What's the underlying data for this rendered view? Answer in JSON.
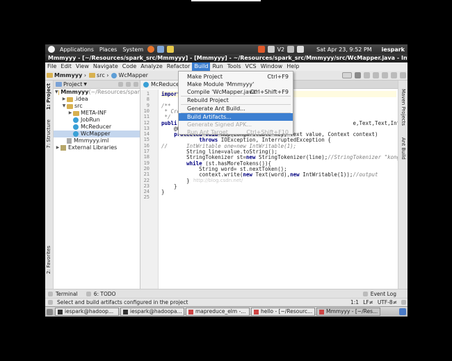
{
  "panel": {
    "menus": [
      "Applications",
      "Places",
      "System"
    ],
    "clock": "Sat Apr 23,  9:52 PM",
    "user": "iespark",
    "indicator": "V2"
  },
  "window": {
    "title": "Mmmyyy - [~/Resources/spark_src/Mmmyyy] - [Mmmyyy] - ~/Resources/spark_src/Mmmyyy/src/WcMapper.java - IntelliJ"
  },
  "menubar": [
    "File",
    "Edit",
    "View",
    "Navigate",
    "Code",
    "Analyze",
    "Refactor",
    "Build",
    "Run",
    "Tools",
    "VCS",
    "Window",
    "Help"
  ],
  "breadcrumbs": [
    "Mmmyyy",
    "src",
    "WcMapper"
  ],
  "project": {
    "header": "Project",
    "tree": [
      {
        "label": "Mmmyyy",
        "suffix": " (~/Resources/spar",
        "indent": 0,
        "arrow": "▼",
        "icon": "folder"
      },
      {
        "label": ".idea",
        "indent": 1,
        "arrow": "▶",
        "icon": "folder"
      },
      {
        "label": "src",
        "indent": 1,
        "arrow": "▼",
        "icon": "folder"
      },
      {
        "label": "META-INF",
        "indent": 2,
        "arrow": "▶",
        "icon": "folder"
      },
      {
        "label": "JobRun",
        "indent": 2,
        "arrow": "",
        "icon": "class"
      },
      {
        "label": "McReducer",
        "indent": 2,
        "arrow": "",
        "icon": "class"
      },
      {
        "label": "WcMapper",
        "indent": 2,
        "arrow": "",
        "icon": "class"
      },
      {
        "label": "Mmmyyy.iml",
        "indent": 1,
        "arrow": "",
        "icon": "iml"
      },
      {
        "label": "External Libraries",
        "indent": 0,
        "arrow": "▶",
        "icon": "lib"
      }
    ]
  },
  "editor": {
    "tab": "McReducer.",
    "line_numbers": [
      "1",
      "8",
      "9",
      "10",
      "11",
      "12",
      "13",
      "14",
      "15",
      "16",
      "17",
      "18",
      "19",
      "20",
      "21",
      "22",
      "23",
      "24",
      "25"
    ],
    "lines": [
      "import",
      "",
      "/**",
      " * Cre",
      " */",
      "publi                                                        e,Text,Text,IntWritable>{",
      "    @O",
      "    protected void map(LongWritable key, Text value, Context context)",
      "            throws IOException, InterruptedException {",
      "//      IntWritable one=new IntWritable(1);",
      "        String line=value.toString();",
      "        StringTokenizer st=new StringTokenizer(line);//StringTokenizer \"kongge\"",
      "        while (st.hasMoreTokens()){",
      "            String word= st.nextToken();",
      "            context.write(new Text(word),new IntWritable(1));//output",
      "        }",
      "    }",
      "}",
      ""
    ],
    "watermark": "http://blog.csdn.net/"
  },
  "build_menu": {
    "items": [
      {
        "label": "Make Project",
        "shortcut": "Ctrl+F9",
        "state": "normal"
      },
      {
        "label": "Make Module 'Mmmyyy'",
        "shortcut": "",
        "state": "normal"
      },
      {
        "label": "Compile 'WcMapper.java'",
        "shortcut": "Ctrl+Shift+F9",
        "state": "normal"
      },
      {
        "label": "Rebuild Project",
        "shortcut": "",
        "state": "normal"
      },
      {
        "label": "Generate Ant Build...",
        "shortcut": "",
        "state": "normal"
      },
      {
        "label": "Build Artifacts...",
        "shortcut": "",
        "state": "selected"
      },
      {
        "label": "Generate Signed APK...",
        "shortcut": "",
        "state": "disabled"
      },
      {
        "label": "Run Ant Target",
        "shortcut": "Ctrl+Shift+F10",
        "state": "disabled"
      }
    ]
  },
  "left_tabs": [
    "1: Project",
    "7: Structure",
    "2: Favorites"
  ],
  "right_tabs": [
    "Maven Projects",
    "Ant Build"
  ],
  "bottom_tools": {
    "terminal": "Terminal",
    "todo": "6: TODO",
    "event_log": "Event Log"
  },
  "status": {
    "message": "Select and build artifacts configured in the project",
    "position": "1:1",
    "line_sep": "LF≠",
    "encoding": "UTF-8≠"
  },
  "taskbar": [
    "iespark@hadoop...",
    "iespark@hadoopa...",
    "mapreduce_elm -...",
    "hello - [~/Resourc...",
    "Mmmyyy - [~/Res..."
  ]
}
